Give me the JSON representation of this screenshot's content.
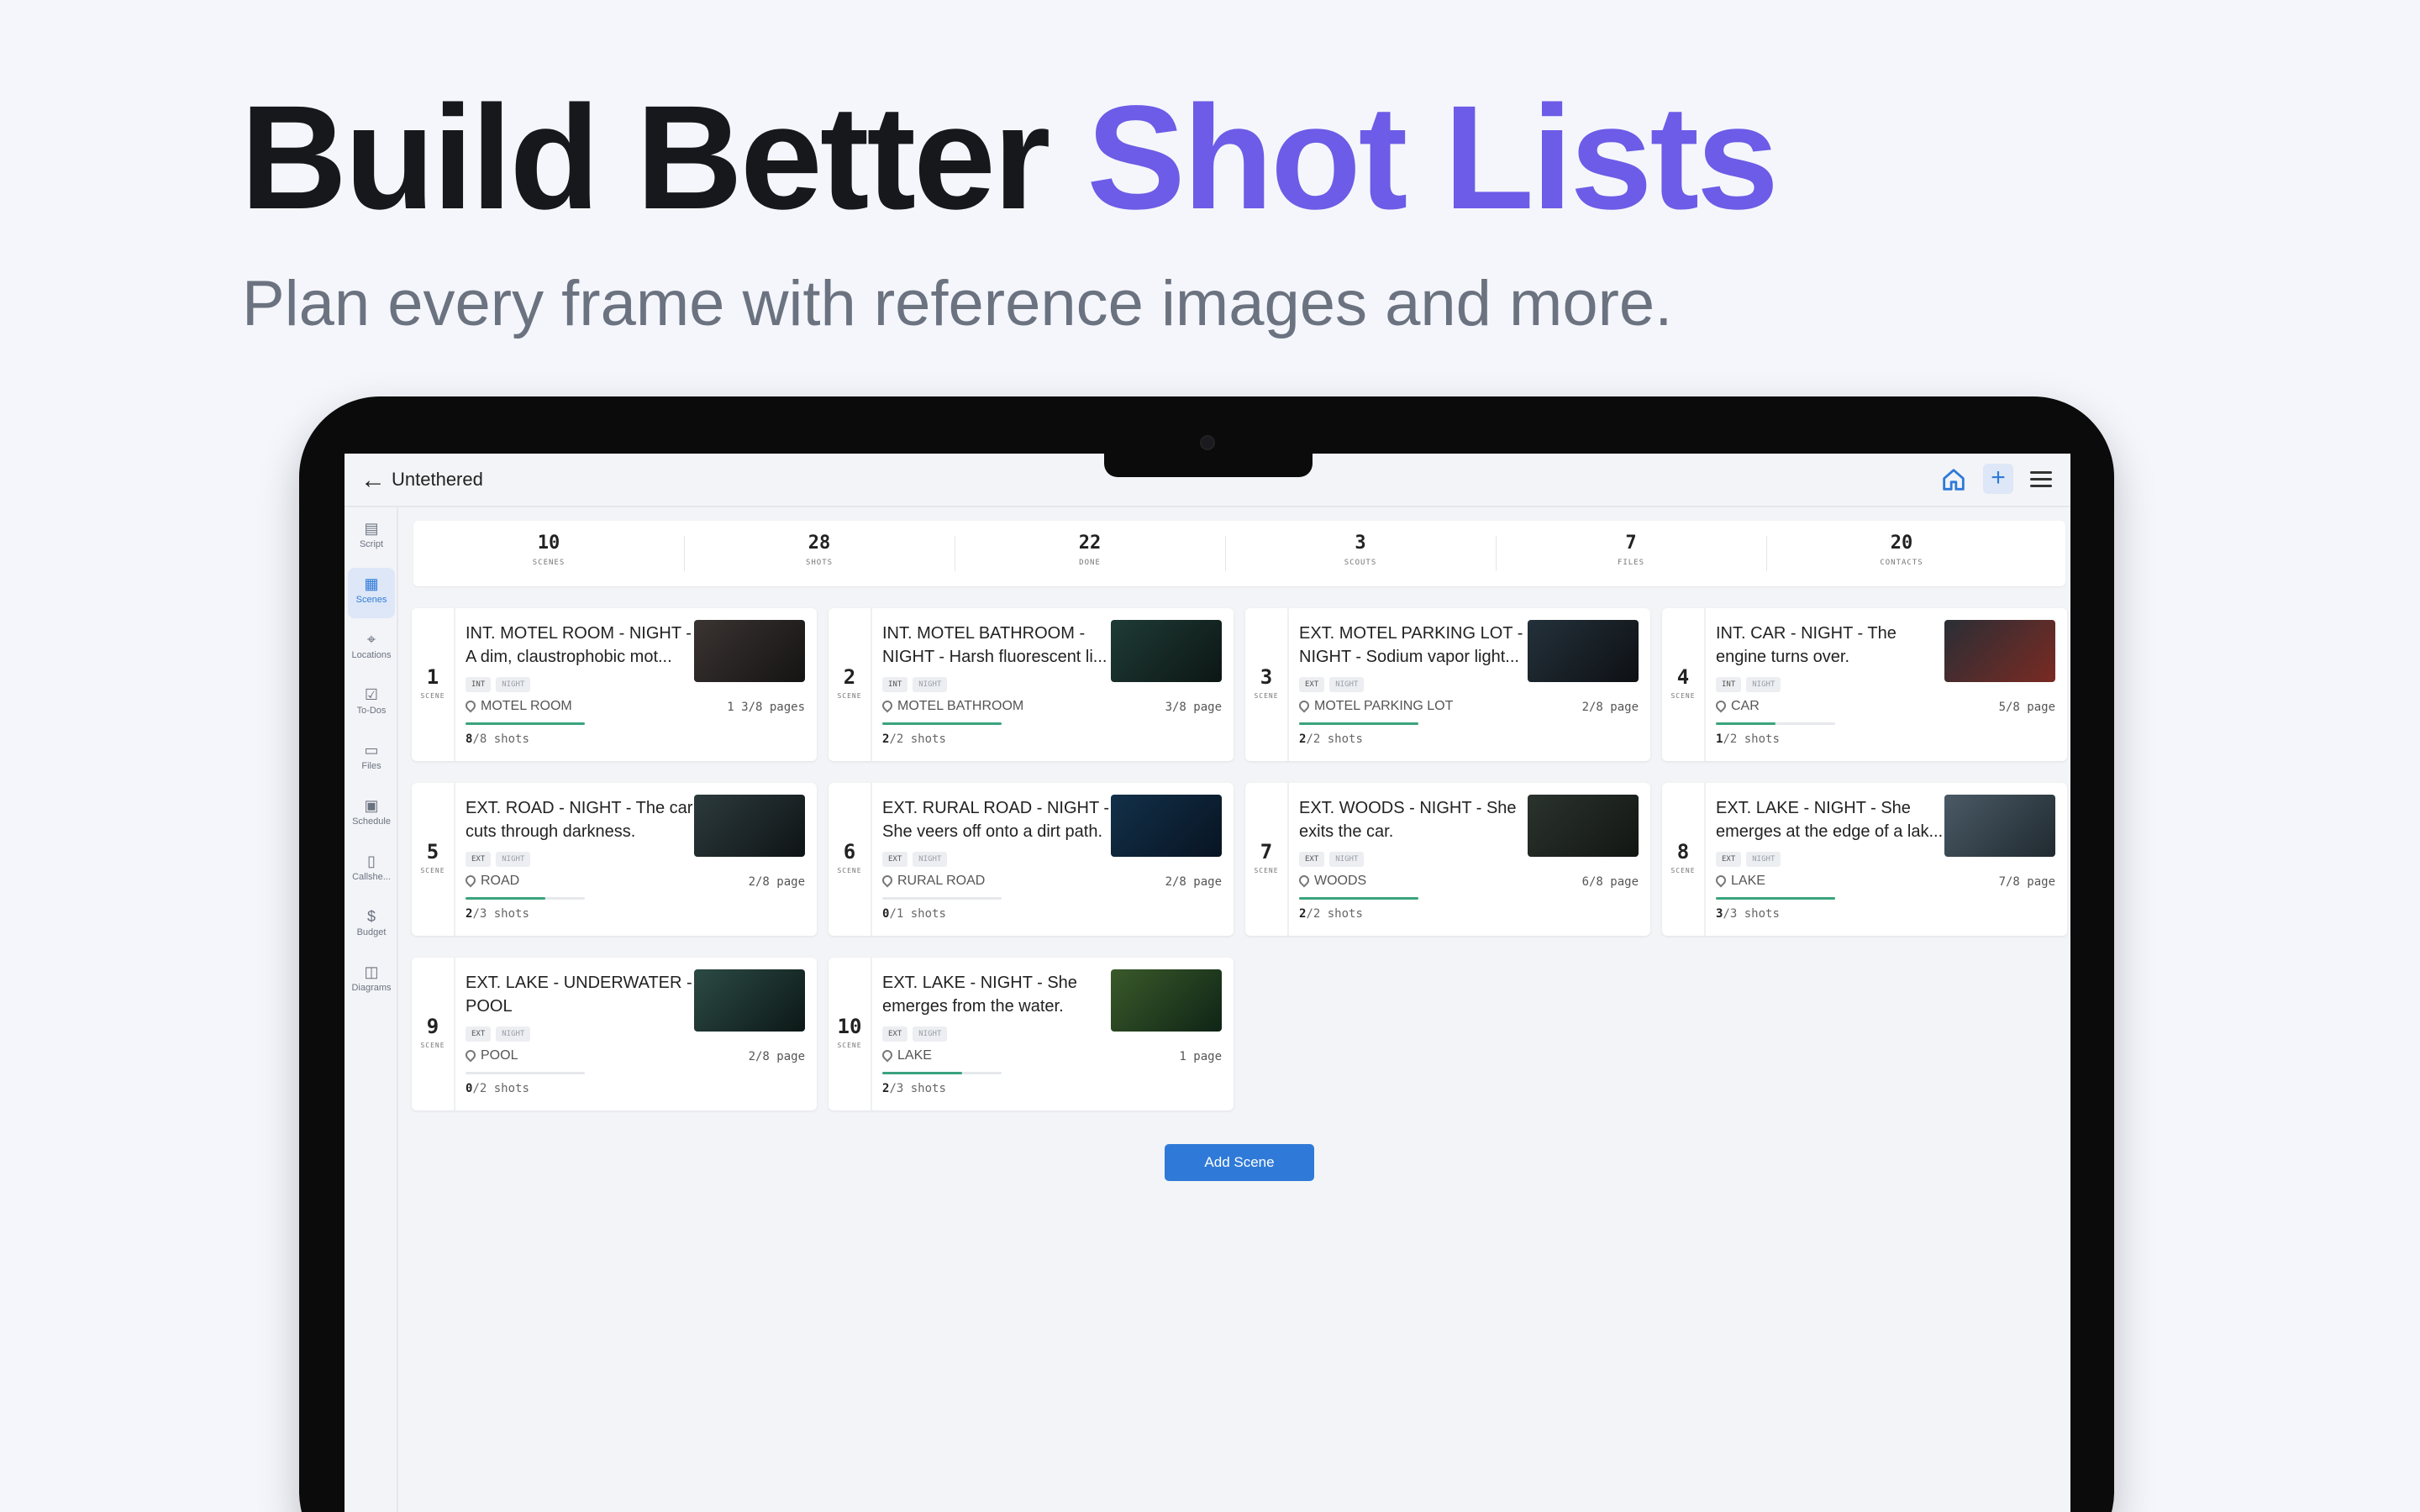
{
  "hero": {
    "title_main": "Build Better ",
    "title_accent": "Shot Lists",
    "subtitle": "Plan every frame with reference images and more."
  },
  "app": {
    "project_title": "Untethered",
    "plus_label": "+",
    "add_scene_label": "Add Scene"
  },
  "sidebar": {
    "items": [
      {
        "label": "Script",
        "icon": "document-icon",
        "active": false
      },
      {
        "label": "Scenes",
        "icon": "grid-icon",
        "active": true
      },
      {
        "label": "Locations",
        "icon": "map-pin-icon",
        "active": false
      },
      {
        "label": "To-Dos",
        "icon": "checkbox-icon",
        "active": false
      },
      {
        "label": "Files",
        "icon": "folder-icon",
        "active": false
      },
      {
        "label": "Schedule",
        "icon": "calendar-icon",
        "active": false
      },
      {
        "label": "Callshe...",
        "icon": "clipboard-icon",
        "active": false
      },
      {
        "label": "Budget",
        "icon": "dollar-icon",
        "active": false
      },
      {
        "label": "Diagrams",
        "icon": "layout-icon",
        "active": false
      }
    ]
  },
  "stats": [
    {
      "value": "10",
      "label": "SCENES"
    },
    {
      "value": "28",
      "label": "SHOTS"
    },
    {
      "value": "22",
      "label": "DONE"
    },
    {
      "value": "3",
      "label": "SCOUTS"
    },
    {
      "value": "7",
      "label": "FILES"
    },
    {
      "value": "20",
      "label": "CONTACTS"
    }
  ],
  "scene_label": "SCENE",
  "scenes": [
    {
      "number": "1",
      "title": "INT. MOTEL ROOM - NIGHT - A dim, claustrophobic mot...",
      "tag1": "INT",
      "tag2": "NIGHT",
      "location": "MOTEL ROOM",
      "pages": "1 3/8 pages",
      "shots_done": "8",
      "shots_rest": "/8 shots",
      "progress": 1.0,
      "thumb_colors": [
        "#3a3432",
        "#151313"
      ]
    },
    {
      "number": "2",
      "title": "INT. MOTEL BATHROOM - NIGHT - Harsh fluorescent li...",
      "tag1": "INT",
      "tag2": "NIGHT",
      "location": "MOTEL BATHROOM",
      "pages": "3/8 page",
      "shots_done": "2",
      "shots_rest": "/2 shots",
      "progress": 1.0,
      "thumb_colors": [
        "#1f3b36",
        "#0c1614"
      ]
    },
    {
      "number": "3",
      "title": "EXT. MOTEL PARKING LOT - NIGHT - Sodium vapor light...",
      "tag1": "EXT",
      "tag2": "NIGHT",
      "location": "MOTEL PARKING LOT",
      "pages": "2/8 page",
      "shots_done": "2",
      "shots_rest": "/2 shots",
      "progress": 1.0,
      "thumb_colors": [
        "#24313a",
        "#0d1014"
      ]
    },
    {
      "number": "4",
      "title": "INT. CAR - NIGHT - The engine turns over.",
      "tag1": "INT",
      "tag2": "NIGHT",
      "location": "CAR",
      "pages": "5/8 page",
      "shots_done": "1",
      "shots_rest": "/2 shots",
      "progress": 0.5,
      "thumb_colors": [
        "#2a2e36",
        "#7a2a22"
      ]
    },
    {
      "number": "5",
      "title": "EXT. ROAD - NIGHT - The car cuts through darkness.",
      "tag1": "EXT",
      "tag2": "NIGHT",
      "location": "ROAD",
      "pages": "2/8 page",
      "shots_done": "2",
      "shots_rest": "/3 shots",
      "progress": 0.67,
      "thumb_colors": [
        "#2c3a3c",
        "#0f1416"
      ]
    },
    {
      "number": "6",
      "title": "EXT. RURAL ROAD - NIGHT - She veers off onto a dirt path.",
      "tag1": "EXT",
      "tag2": "NIGHT",
      "location": "RURAL ROAD",
      "pages": "2/8 page",
      "shots_done": "0",
      "shots_rest": "/1 shots",
      "progress": 0.0,
      "thumb_colors": [
        "#123049",
        "#081422"
      ]
    },
    {
      "number": "7",
      "title": "EXT. WOODS - NIGHT - She exits the car.",
      "tag1": "EXT",
      "tag2": "NIGHT",
      "location": "WOODS",
      "pages": "6/8 page",
      "shots_done": "2",
      "shots_rest": "/2 shots",
      "progress": 1.0,
      "thumb_colors": [
        "#2b332e",
        "#121613"
      ]
    },
    {
      "number": "8",
      "title": "EXT. LAKE - NIGHT - She emerges at the edge of a lak...",
      "tag1": "EXT",
      "tag2": "NIGHT",
      "location": "LAKE",
      "pages": "7/8 page",
      "shots_done": "3",
      "shots_rest": "/3 shots",
      "progress": 1.0,
      "thumb_colors": [
        "#4a5a66",
        "#202a30"
      ]
    },
    {
      "number": "9",
      "title": "EXT. LAKE - UNDERWATER - POOL",
      "tag1": "EXT",
      "tag2": "NIGHT",
      "location": "POOL",
      "pages": "2/8 page",
      "shots_done": "0",
      "shots_rest": "/2 shots",
      "progress": 0.0,
      "thumb_colors": [
        "#2c4a44",
        "#0c1817"
      ]
    },
    {
      "number": "10",
      "title": "EXT. LAKE - NIGHT - She emerges from the water.",
      "tag1": "EXT",
      "tag2": "NIGHT",
      "location": "LAKE",
      "pages": "1 page",
      "shots_done": "2",
      "shots_rest": "/3 shots",
      "progress": 0.67,
      "thumb_colors": [
        "#3a5a2a",
        "#0f2416"
      ]
    }
  ]
}
